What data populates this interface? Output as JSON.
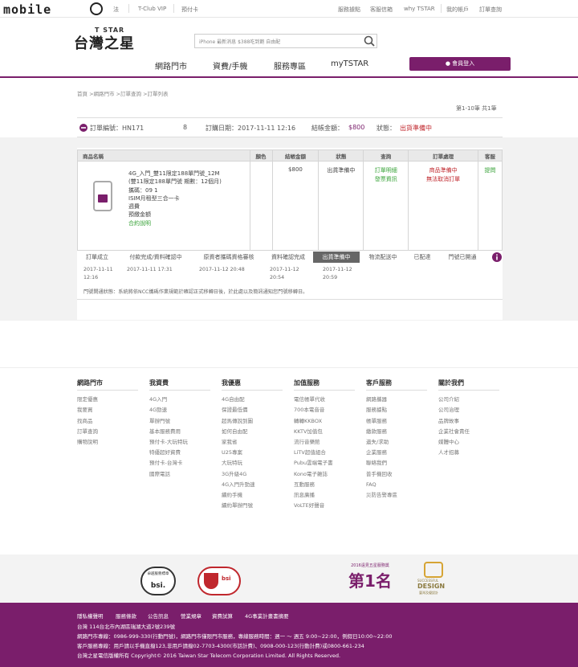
{
  "topbar": {
    "logo_text": "mobile",
    "links_left": [
      "法",
      "T-Club VIP",
      "預付卡"
    ],
    "links_right": [
      "服務據點",
      "客服信箱",
      "why TSTAR",
      "我的帳戶",
      "訂單查詢"
    ]
  },
  "header": {
    "brand_en": "T STAR",
    "brand_zh": "台灣之星",
    "search_placeholder": "iPhone 最新消息 $388吃到飽 自由配",
    "nav": [
      "網路門市",
      "資費/手機",
      "服務專區",
      "myTSTAR"
    ],
    "login_label": "會員登入"
  },
  "breadcrumb": "首頁 >網路門市 >訂單查詢 >訂單列表",
  "page_info": "第1-10筆 共1筆",
  "order": {
    "number_label": "訂單編號：HN171",
    "number_suffix": "8",
    "date_label": "訂購日期：2017-11-11 12:16",
    "amount_label": "結帳金額：",
    "amount_value": "$800",
    "status_label": "狀態：",
    "status_value": "出貨準備中"
  },
  "table": {
    "headers": [
      "商品名稱",
      "顏色",
      "結帳金額",
      "狀態",
      "查詢",
      "訂單處理",
      "客服"
    ],
    "product_lines": [
      "4G_入門_雙11限定188單門號_12M",
      "(雙11限定188單門號 期數：12個月)",
      "攜碼：09        1",
      "ISIM月租型三合一卡",
      "週費",
      "預繳金額",
      "合約說明"
    ],
    "amount": "$800",
    "status": "出貨準備中",
    "query_links": [
      "訂單明細",
      "發票資訊"
    ],
    "process_lines": [
      "商品準備中",
      "無法取消訂單"
    ],
    "service": "提問"
  },
  "steps": {
    "labels": [
      "訂單成立",
      "付款完成/資料確認中",
      "原資者攜碼資格審核",
      "資料確認完成",
      "出貨準備中",
      "物流配送中",
      "已配達",
      "門號已開通"
    ],
    "dates": [
      "2017-11-11\n12:16",
      "2017-11-11 17:31",
      "2017-11-12 20:48",
      "2017-11-12\n20:54",
      "2017-11-12\n20:59"
    ]
  },
  "note": "門號開通狀態：系統將依NCC攜碼作業規範於確認正式移轉日後，於此處以及簡訊通知您門號移轉日。",
  "footer": {
    "columns": [
      {
        "head": "網路門市",
        "items": [
          "限定優惠",
          "我要買",
          "找商品",
          "訂單查詢",
          "購物說明"
        ]
      },
      {
        "head": "我資費",
        "items": [
          "4G入門",
          "4G勁速",
          "單辦門號",
          "基本服務費用",
          "預付卡-大玩特玩",
          "特優超好資費",
          "預付卡-台灣卡",
          "國際電話"
        ]
      },
      {
        "head": "我優惠",
        "items": [
          "4G自由配",
          "保證最低價",
          "超馬傳說到圖",
          "如何自由配",
          "家我省",
          "U25專案",
          "大玩特玩",
          "3G升級4G",
          "4G入門升勁速",
          "續約手機",
          "續約單辦門號"
        ]
      },
      {
        "head": "加值服務",
        "items": [
          "電信帳單代收",
          "700本電音音",
          "轉轉KKBOX",
          "KKTV加值包",
          "流行音樂館",
          "LiTV超值組合",
          "Pubu雲端電子書",
          "Kono電子雜誌",
          "互動服務",
          "訊息廣播",
          "VoLTE好聲音"
        ]
      },
      {
        "head": "客戶服務",
        "items": [
          "網路攜器",
          "服務據點",
          "帳單服務",
          "繳款服務",
          "遺失/求助",
          "企業服務",
          "聯絡我們",
          "普手機回收",
          "FAQ",
          "災防告警專區"
        ]
      },
      {
        "head": "關於我們",
        "items": [
          "公司介紹",
          "公司治理",
          "品牌故事",
          "企業社會責任",
          "媒體中心",
          "人才招募"
        ]
      }
    ]
  },
  "certs": {
    "badge1_top": "卓越服務標章",
    "badge1_brand": "bsi.",
    "badge2_brand": "bsi",
    "award_top": "2016遠見五星服務獎",
    "award_main": "第1名",
    "design_top": "SUCCESSFUL",
    "design_main": "DESIGN",
    "design_sub": "臺灣及優設計"
  },
  "bottom": {
    "links": [
      "隱私權聲明",
      "服務條款",
      "公告訊息",
      "營業規章",
      "資費試算",
      "4G事業計畫書摘要"
    ],
    "address": "台灣 114台北市內湖區瑞湖大道2號239號",
    "line2": "網路門市專線：0986-999-330(行動門號)，網路門市僅限門市服務，專線服務時間：週一 ～ 週五 9:00~22:00，例假日10:00~22:00",
    "line3": "客戶服務專線：用戶請以手機直撥123,非用戶請撥02-7703-4300(市話計費)、0908-000-123(行動計費)或0800-661-234",
    "copyright": "台灣之星電信版權所有 Copyright© 2016 Taiwan Star Telecom Corporation Limited. All Rights Reserved."
  },
  "colors": {
    "brand": "#7a1e6b",
    "status_red": "#c0272d",
    "link_green": "#3aa33a"
  }
}
